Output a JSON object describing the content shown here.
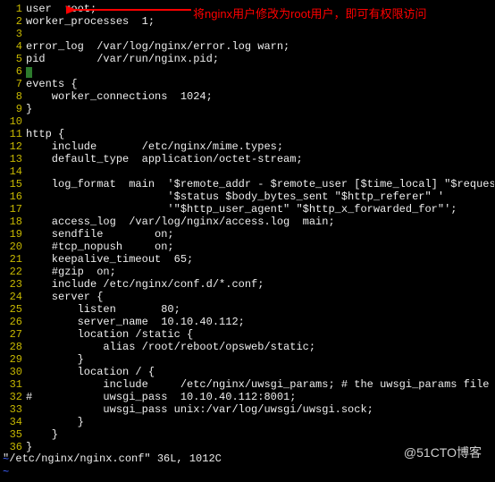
{
  "annotation": {
    "text": "将nginx用户修改为root用户，即可有权限访问"
  },
  "lines": [
    {
      "n": "1",
      "t": "user  root;"
    },
    {
      "n": "2",
      "t": "worker_processes  1;"
    },
    {
      "n": "3",
      "t": ""
    },
    {
      "n": "4",
      "t": "error_log  /var/log/nginx/error.log warn;"
    },
    {
      "n": "5",
      "t": "pid        /var/run/nginx.pid;"
    },
    {
      "n": "6",
      "t": "",
      "cursor": true
    },
    {
      "n": "7",
      "t": "events {"
    },
    {
      "n": "8",
      "t": "    worker_connections  1024;"
    },
    {
      "n": "9",
      "t": "}"
    },
    {
      "n": "10",
      "t": ""
    },
    {
      "n": "11",
      "t": "http {"
    },
    {
      "n": "12",
      "t": "    include       /etc/nginx/mime.types;"
    },
    {
      "n": "13",
      "t": "    default_type  application/octet-stream;"
    },
    {
      "n": "14",
      "t": ""
    },
    {
      "n": "15",
      "t": "    log_format  main  '$remote_addr - $remote_user [$time_local] \"$request\" '"
    },
    {
      "n": "16",
      "t": "                      '$status $body_bytes_sent \"$http_referer\" '"
    },
    {
      "n": "17",
      "t": "                      '\"$http_user_agent\" \"$http_x_forwarded_for\"';"
    },
    {
      "n": "18",
      "t": "    access_log  /var/log/nginx/access.log  main;"
    },
    {
      "n": "19",
      "t": "    sendfile        on;"
    },
    {
      "n": "20",
      "t": "    #tcp_nopush     on;"
    },
    {
      "n": "21",
      "t": "    keepalive_timeout  65;"
    },
    {
      "n": "22",
      "t": "    #gzip  on;"
    },
    {
      "n": "23",
      "t": "    include /etc/nginx/conf.d/*.conf;"
    },
    {
      "n": "24",
      "t": "    server {"
    },
    {
      "n": "25",
      "t": "        listen       80;"
    },
    {
      "n": "26",
      "t": "        server_name  10.10.40.112;"
    },
    {
      "n": "27",
      "t": "        location /static {"
    },
    {
      "n": "28",
      "t": "            alias /root/reboot/opsweb/static;"
    },
    {
      "n": "29",
      "t": "        }"
    },
    {
      "n": "30",
      "t": "        location / {"
    },
    {
      "n": "31",
      "t": "            include     /etc/nginx/uwsgi_params; # the uwsgi_params file you installed"
    },
    {
      "n": "32",
      "t": "#           uwsgi_pass  10.10.40.112:8001;"
    },
    {
      "n": "33",
      "t": "            uwsgi_pass unix:/var/log/uwsgi/uwsgi.sock;"
    },
    {
      "n": "34",
      "t": "        }"
    },
    {
      "n": "35",
      "t": "    }"
    },
    {
      "n": "36",
      "t": "}"
    }
  ],
  "tildes": [
    "~",
    "~"
  ],
  "status_line": "\"/etc/nginx/nginx.conf\" 36L, 1012C",
  "watermark": "@51CTO博客"
}
